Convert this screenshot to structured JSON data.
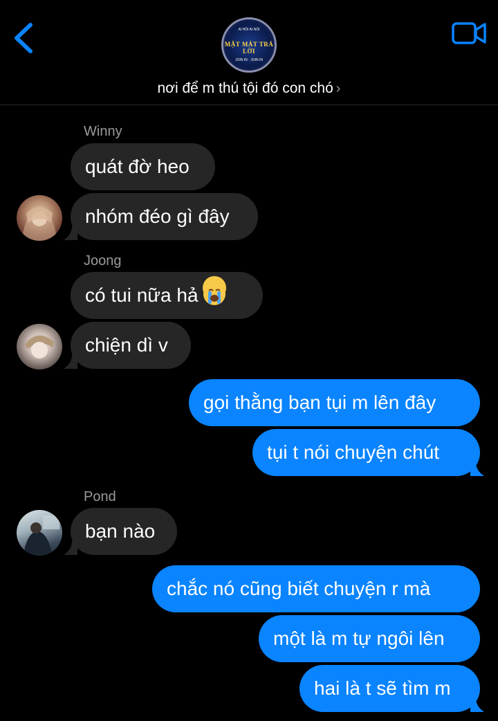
{
  "header": {
    "title": "nơi để m thú tội đó con chó",
    "logo_text_top": "AI HỎI AI NÓI",
    "logo_text_main": "MẶT MÁT TRẢ LỜI",
    "logo_text_bottom": "JOIN IN · JOIN IN"
  },
  "messages": [
    {
      "sender": "Winny"
    },
    {
      "text": "quát đờ heo"
    },
    {
      "text": "nhóm đéo gì đây"
    },
    {
      "sender": "Joong"
    },
    {
      "text": "có tui nữa hả",
      "emoji": "loudly-crying-face"
    },
    {
      "text": "chiện dì v"
    },
    {
      "text": "gọi thằng bạn tụi m lên đây"
    },
    {
      "text": "tụi t nói chuyện chút"
    },
    {
      "sender": "Pond"
    },
    {
      "text": "bạn nào"
    },
    {
      "text": "chắc nó cũng biết chuyện r mà"
    },
    {
      "text": "một là m tự ngôi lên"
    },
    {
      "text": "hai là t sẽ tìm m"
    }
  ],
  "colors": {
    "outgoing": "#0a84ff",
    "incoming": "#262626",
    "accent": "#0a84ff"
  }
}
